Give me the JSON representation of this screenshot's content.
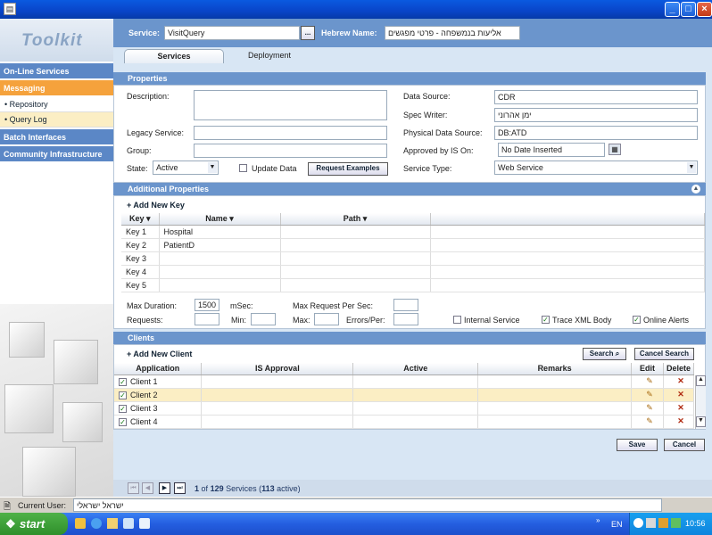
{
  "window": {
    "icon": "app-icon",
    "controls": [
      "_",
      "□",
      "×"
    ]
  },
  "sidebar": {
    "logo": "Toolkit",
    "items": [
      {
        "label": "On-Line Services",
        "type": "header"
      },
      {
        "label": "Messaging",
        "type": "header-active"
      },
      {
        "label": "• Repository",
        "type": "sub"
      },
      {
        "label": "• Query Log",
        "type": "sub-selected"
      },
      {
        "label": "Batch Interfaces",
        "type": "header"
      },
      {
        "label": "Community Infrastructure",
        "type": "header"
      }
    ]
  },
  "header": {
    "service_label": "Service:",
    "service_value": "VisitQuery",
    "browse": "...",
    "hebrew_label": "Hebrew Name:",
    "hebrew_value": "אליעות בנמשפחה - פרטי מפגשים"
  },
  "tabs": [
    "Services",
    "Deployment"
  ],
  "properties": {
    "title": "Properties",
    "description_label": "Description:",
    "legacy_label": "Legacy Service:",
    "group_label": "Group:",
    "state_label": "State:",
    "state_value": "Active",
    "update_data_label": "Update Data",
    "request_examples": "Request Examples",
    "data_source_label": "Data Source:",
    "data_source_value": "CDR",
    "spec_writer_label": "Spec Writer:",
    "spec_writer_value": "ימן אהרוני",
    "physical_label": "Physical Data Source:",
    "physical_value": "DB:ATD",
    "approved_label": "Approved by IS On:",
    "approved_value": "No Date Inserted",
    "service_type_label": "Service Type:",
    "service_type_value": "Web Service"
  },
  "additional": {
    "title": "Additional Properties",
    "add_key": "+ Add New Key",
    "columns": [
      "Key ▾",
      "Name ▾",
      "Path ▾"
    ],
    "rows": [
      {
        "key": "Key 1",
        "name": "Hospital",
        "path": ""
      },
      {
        "key": "Key 2",
        "name": "PatientD",
        "path": ""
      },
      {
        "key": "Key 3",
        "name": "",
        "path": ""
      },
      {
        "key": "Key 4",
        "name": "",
        "path": ""
      },
      {
        "key": "Key 5",
        "name": "",
        "path": ""
      }
    ],
    "max_duration_label": "Max Duration:",
    "max_duration_value": "1500",
    "msec": "mSec:",
    "max_req_label": "Max Request Per Sec:",
    "requests_label": "Requests:",
    "min_label": "Min:",
    "max_label": "Max:",
    "errors_label": "Errors/Per:",
    "internal_service": "Internal Service",
    "trace_xml": "Trace XML Body",
    "online_alerts": "Online Alerts"
  },
  "clients": {
    "title": "Clients",
    "add_client": "+ Add New Client",
    "search": "Search",
    "cancel_search": "Cancel Search",
    "columns": [
      "Application",
      "IS Approval",
      "Active",
      "Remarks",
      "Edit",
      "Delete"
    ],
    "rows": [
      "Client 1",
      "Client 2",
      "Client 3",
      "Client 4"
    ]
  },
  "actions": {
    "save": "Save",
    "cancel": "Cancel"
  },
  "footer": {
    "page": "1",
    "of": "of",
    "total": "129",
    "services": "Services (",
    "active_count": "113",
    "active_word": "active)"
  },
  "status": {
    "current_user_label": "Current User:",
    "current_user_value": "ישראל ישראלי"
  },
  "taskbar": {
    "start": "start",
    "lang": "EN",
    "time": "10:56"
  },
  "colors": {
    "header_blue": "#6b95cc",
    "accent_orange": "#f5a23c",
    "selected_row": "#fbeec4"
  }
}
